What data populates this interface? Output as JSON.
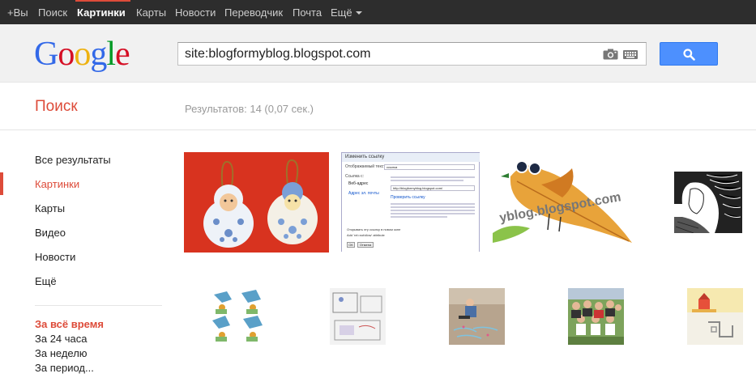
{
  "topbar": {
    "items": [
      {
        "label": "+Вы"
      },
      {
        "label": "Поиск"
      },
      {
        "label": "Картинки"
      },
      {
        "label": "Карты"
      },
      {
        "label": "Новости"
      },
      {
        "label": "Переводчик"
      },
      {
        "label": "Почта"
      },
      {
        "label": "Ещё"
      }
    ],
    "active_index": 2
  },
  "header": {
    "logo": "Google",
    "search_value": "site:blogformyblog.blogspot.com"
  },
  "results": {
    "section_title": "Поиск",
    "stats": "Результатов: 14 (0,07 сек.)"
  },
  "leftnav": {
    "items": [
      {
        "label": "Все результаты"
      },
      {
        "label": "Картинки"
      },
      {
        "label": "Карты"
      },
      {
        "label": "Видео"
      },
      {
        "label": "Новости"
      },
      {
        "label": "Ещё"
      }
    ],
    "active_index": 1,
    "time_tools": [
      {
        "label": "За всё время"
      },
      {
        "label": "За 24 часа"
      },
      {
        "label": "За неделю"
      },
      {
        "label": "За период..."
      }
    ]
  },
  "thumbs": {
    "dialog": {
      "title": "Изменить ссылку",
      "text_label": "Отображаемый текст:",
      "text_value": "ссылка",
      "link_label": "Ссылка с:",
      "web_option": "Веб-адрес",
      "email_option": "Адрес эл. почты",
      "url_value": "http://blogformyblog.blogspot.com/",
      "check_link": "Проверить ссылку",
      "new_window": "Открывать эту ссылку в новом окне",
      "nofollow": "Add 'rel=nofollow' attribute",
      "ok": "ОК",
      "cancel": "Отмена"
    },
    "bird_watermark": "yblog.blogspot.com"
  },
  "colors": {
    "topbar_bg": "#2d2d2d",
    "accent_red": "#dd4b39",
    "search_button": "#4d90fe",
    "header_bg": "#f1f1f1"
  },
  "icons": {
    "camera": "camera-icon",
    "keyboard": "keyboard-icon",
    "search": "magnifier-icon",
    "caret": "chevron-down-icon"
  }
}
